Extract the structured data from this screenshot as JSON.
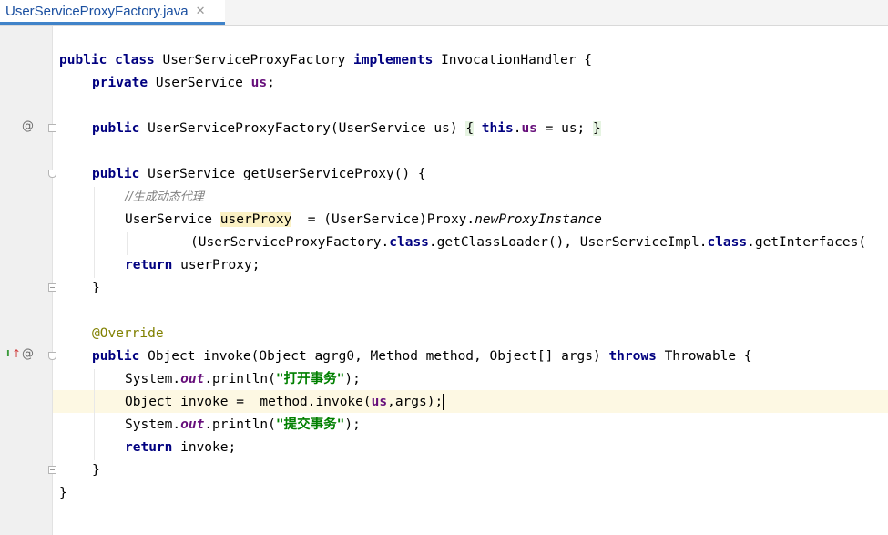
{
  "tab": {
    "title": "UserServiceProxyFactory.java",
    "close_glyph": "✕"
  },
  "gutter": {
    "at_symbol": "@",
    "implements_marker": "I"
  },
  "code": {
    "l1_kw1": "public",
    "l1_kw2": "class",
    "l1_name": " UserServiceProxyFactory ",
    "l1_kw3": "implements",
    "l1_rest": " InvocationHandler {",
    "l2_kw": "private",
    "l2_type": " UserService ",
    "l2_field": "us",
    "l2_end": ";",
    "l3_kw": "public",
    "l3_sig": " UserServiceProxyFactory(UserService us) ",
    "l3_ob": "{",
    "l3_this": "this",
    "l3_dot": ".",
    "l3_field": "us",
    "l3_assign": " = us; ",
    "l3_cb": "}",
    "l4_kw": "public",
    "l4_rest": " UserService getUserServiceProxy() {",
    "l5_comment": "//生成动态代理",
    "l6_type": "UserService ",
    "l6_var": "userProxy",
    "l6_mid": "  = (UserService)Proxy.",
    "l6_method": "newProxyInstance",
    "l7_a": "(UserServiceProxyFactory.",
    "l7_kw1": "class",
    "l7_b": ".getClassLoader(), UserServiceImpl.",
    "l7_kw2": "class",
    "l7_c": ".getInterfaces(",
    "l8_kw": "return",
    "l8_rest": " userProxy;",
    "l9": "}",
    "l10_ann": "@Override",
    "l11_kw": "public",
    "l11_a": " Object invoke(Object agrg0, Method method, Object[] args) ",
    "l11_kw2": "throws",
    "l11_b": " Throwable {",
    "l12_a": "System.",
    "l12_out": "out",
    "l12_b": ".println(",
    "l12_str": "\"打开事务\"",
    "l12_c": ");",
    "l13_a": "Object invoke =  method.invoke(",
    "l13_field": "us",
    "l13_b": ",args);",
    "l14_a": "System.",
    "l14_out": "out",
    "l14_b": ".println(",
    "l14_str": "\"提交事务\"",
    "l14_c": ");",
    "l15_kw": "return",
    "l15_rest": " invoke;",
    "l16": "}",
    "l17": "}"
  }
}
